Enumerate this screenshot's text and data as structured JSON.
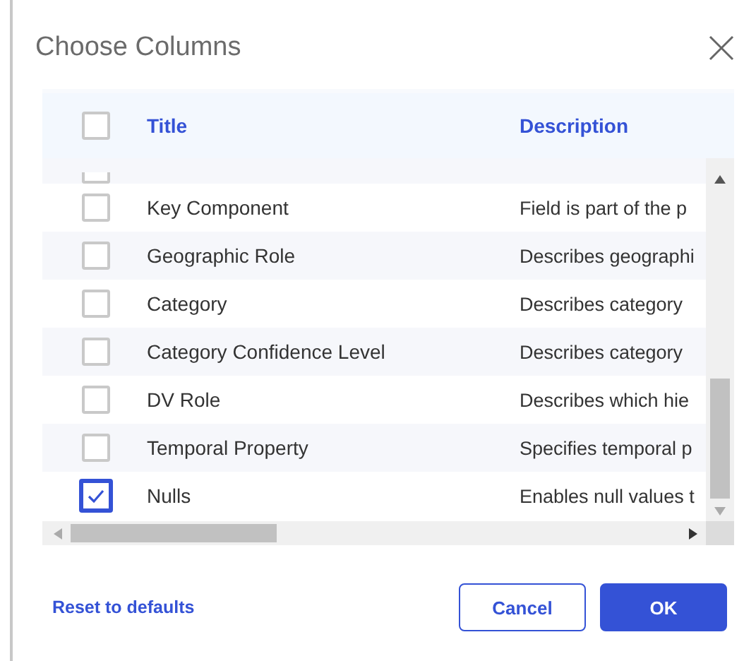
{
  "dialog": {
    "title": "Choose Columns"
  },
  "table": {
    "header_checked": false,
    "columns": [
      "Title",
      "Description"
    ],
    "rows": [
      {
        "title": "Key Component",
        "description": "Field is part of the p",
        "checked": false
      },
      {
        "title": "Geographic Role",
        "description": "Describes geographi",
        "checked": false
      },
      {
        "title": "Category",
        "description": "Describes category",
        "checked": false
      },
      {
        "title": "Category Confidence Level",
        "description": "Describes category",
        "checked": false
      },
      {
        "title": "DV Role",
        "description": "Describes which hie",
        "checked": false
      },
      {
        "title": "Temporal Property",
        "description": "Specifies temporal p",
        "checked": false
      },
      {
        "title": "Nulls",
        "description": "Enables null values t",
        "checked": true
      }
    ]
  },
  "footer": {
    "link": "Reset to defaults",
    "buttons": [
      "Cancel",
      "OK"
    ]
  }
}
